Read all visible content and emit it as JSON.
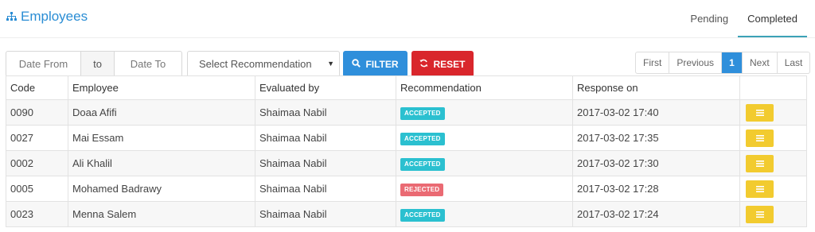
{
  "header": {
    "title": "Employees",
    "tabs": [
      {
        "label": "Pending",
        "active": false
      },
      {
        "label": "Completed",
        "active": true
      }
    ]
  },
  "filters": {
    "date_from_placeholder": "Date From",
    "separator": "to",
    "date_to_placeholder": "Date To",
    "recommendation_select": "Select Recommendation",
    "filter_label": "FILTER",
    "reset_label": "RESET"
  },
  "pagination": {
    "first": "First",
    "previous": "Previous",
    "current": "1",
    "next": "Next",
    "last": "Last"
  },
  "table": {
    "columns": [
      "Code",
      "Employee",
      "Evaluated by",
      "Recommendation",
      "Response on"
    ],
    "rows": [
      {
        "code": "0090",
        "employee": "Doaa Afifi",
        "evaluated_by": "Shaimaa Nabil",
        "recommendation": "ACCEPTED",
        "status": "accepted",
        "response_on": "2017-03-02 17:40"
      },
      {
        "code": "0027",
        "employee": "Mai Essam",
        "evaluated_by": "Shaimaa Nabil",
        "recommendation": "ACCEPTED",
        "status": "accepted",
        "response_on": "2017-03-02 17:35"
      },
      {
        "code": "0002",
        "employee": "Ali Khalil",
        "evaluated_by": "Shaimaa Nabil",
        "recommendation": "ACCEPTED",
        "status": "accepted",
        "response_on": "2017-03-02 17:30"
      },
      {
        "code": "0005",
        "employee": "Mohamed Badrawy",
        "evaluated_by": "Shaimaa Nabil",
        "recommendation": "REJECTED",
        "status": "rejected",
        "response_on": "2017-03-02 17:28"
      },
      {
        "code": "0023",
        "employee": "Menna Salem",
        "evaluated_by": "Shaimaa Nabil",
        "recommendation": "ACCEPTED",
        "status": "accepted",
        "response_on": "2017-03-02 17:24"
      }
    ]
  },
  "icons": {
    "title": "sitemap-icon",
    "filter": "search-icon",
    "reset": "refresh-icon",
    "row_action": "list-icon"
  },
  "colors": {
    "accent": "#2a8dd4",
    "tab_underline": "#3ba2b7",
    "filter_button": "#2f8fdb",
    "reset_button": "#d9262c",
    "accepted_badge": "#2bc0d0",
    "rejected_badge": "#ea6a73",
    "action_button": "#f2cb2f"
  }
}
